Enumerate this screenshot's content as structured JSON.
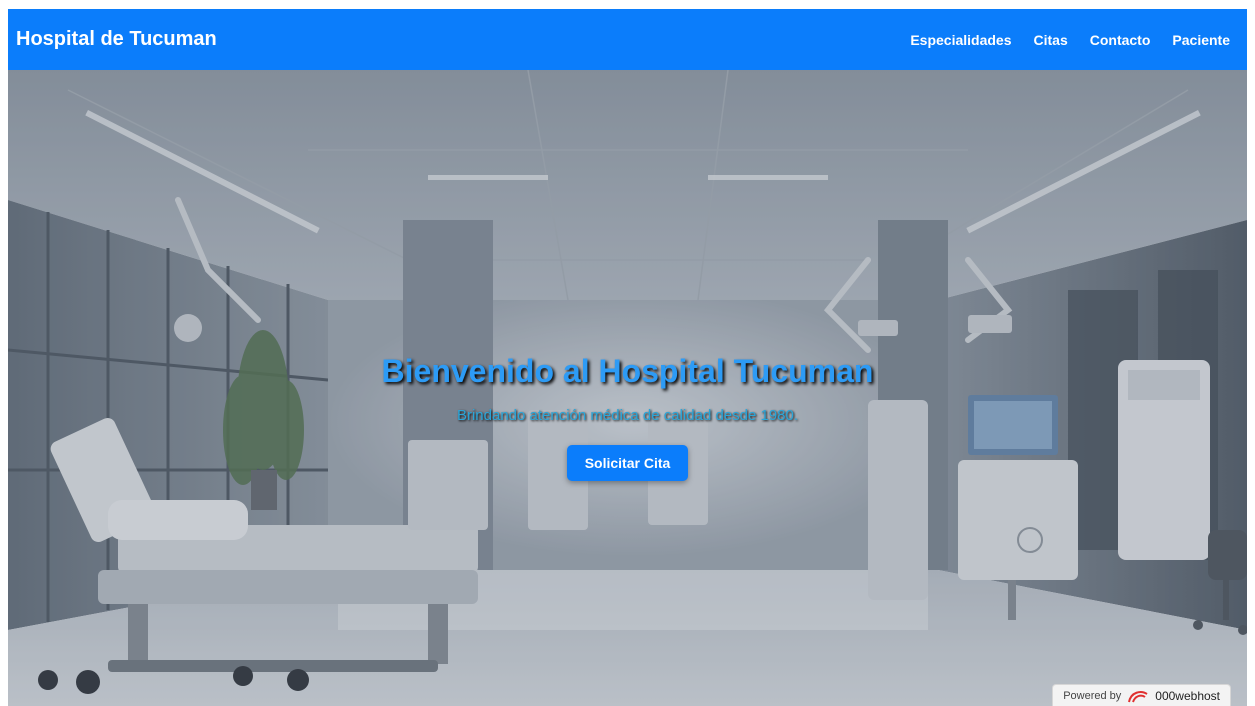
{
  "navbar": {
    "brand": "Hospital de Tucuman",
    "links": [
      {
        "label": "Especialidades"
      },
      {
        "label": "Citas"
      },
      {
        "label": "Contacto"
      },
      {
        "label": "Paciente"
      }
    ]
  },
  "hero": {
    "title": "Bienvenido al Hospital Tucuman",
    "subtitle": "Brindando atención médica de calidad desde 1980.",
    "cta_label": "Solicitar Cita"
  },
  "badge": {
    "prefix": "Powered by",
    "name": "000webhost",
    "icon": "swirl-logo-icon"
  },
  "colors": {
    "primary": "#0b7dfb",
    "title": "#2d9bf5",
    "subtitle": "#2aa6d9"
  }
}
